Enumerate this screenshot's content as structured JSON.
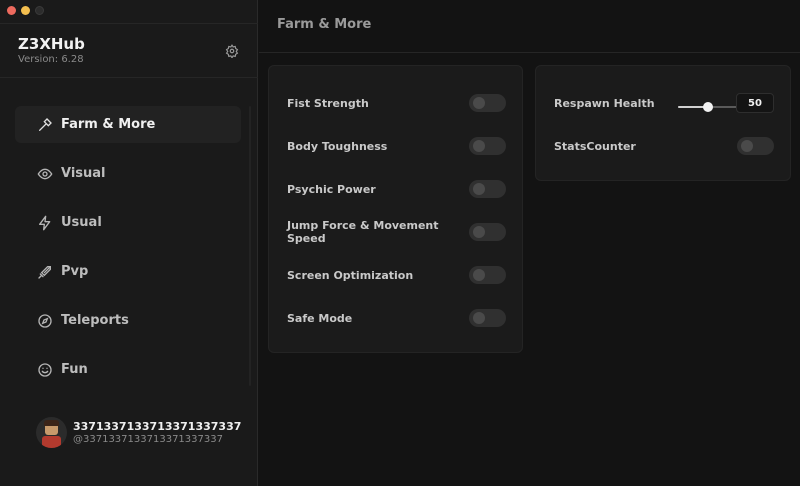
{
  "app": {
    "title": "Z3XHub",
    "version": "Version: 6.28"
  },
  "nav": {
    "items": [
      {
        "label": "Farm & More",
        "icon": "hammer-icon",
        "active": true
      },
      {
        "label": "Visual",
        "icon": "eye-icon",
        "active": false
      },
      {
        "label": "Usual",
        "icon": "bolt-icon",
        "active": false
      },
      {
        "label": "Pvp",
        "icon": "sword-icon",
        "active": false
      },
      {
        "label": "Teleports",
        "icon": "compass-icon",
        "active": false
      },
      {
        "label": "Fun",
        "icon": "smile-icon",
        "active": false
      }
    ]
  },
  "profile": {
    "name": "3371337133713371337337",
    "handle": "@3371337133713371337337"
  },
  "page": {
    "title": "Farm & More"
  },
  "left_card": {
    "toggles": [
      {
        "label": "Fist Strength",
        "on": false
      },
      {
        "label": "Body Toughness",
        "on": false
      },
      {
        "label": "Psychic Power",
        "on": false
      },
      {
        "label": "Jump Force & Movement Speed",
        "on": false
      },
      {
        "label": "Screen Optimization",
        "on": false
      },
      {
        "label": "Safe Mode",
        "on": false
      }
    ]
  },
  "right_card": {
    "respawn_health": {
      "label": "Respawn Health",
      "value": "50",
      "slider_fraction": 0.5
    },
    "stats_counter": {
      "label": "StatsCounter",
      "on": false
    }
  },
  "colors": {
    "window_bg": "#131313",
    "sidebar_bg": "#1a1a1a",
    "card_bg": "#1b1b1b",
    "traffic_red": "#ed6a5e",
    "traffic_yellow": "#f4bf4f"
  }
}
